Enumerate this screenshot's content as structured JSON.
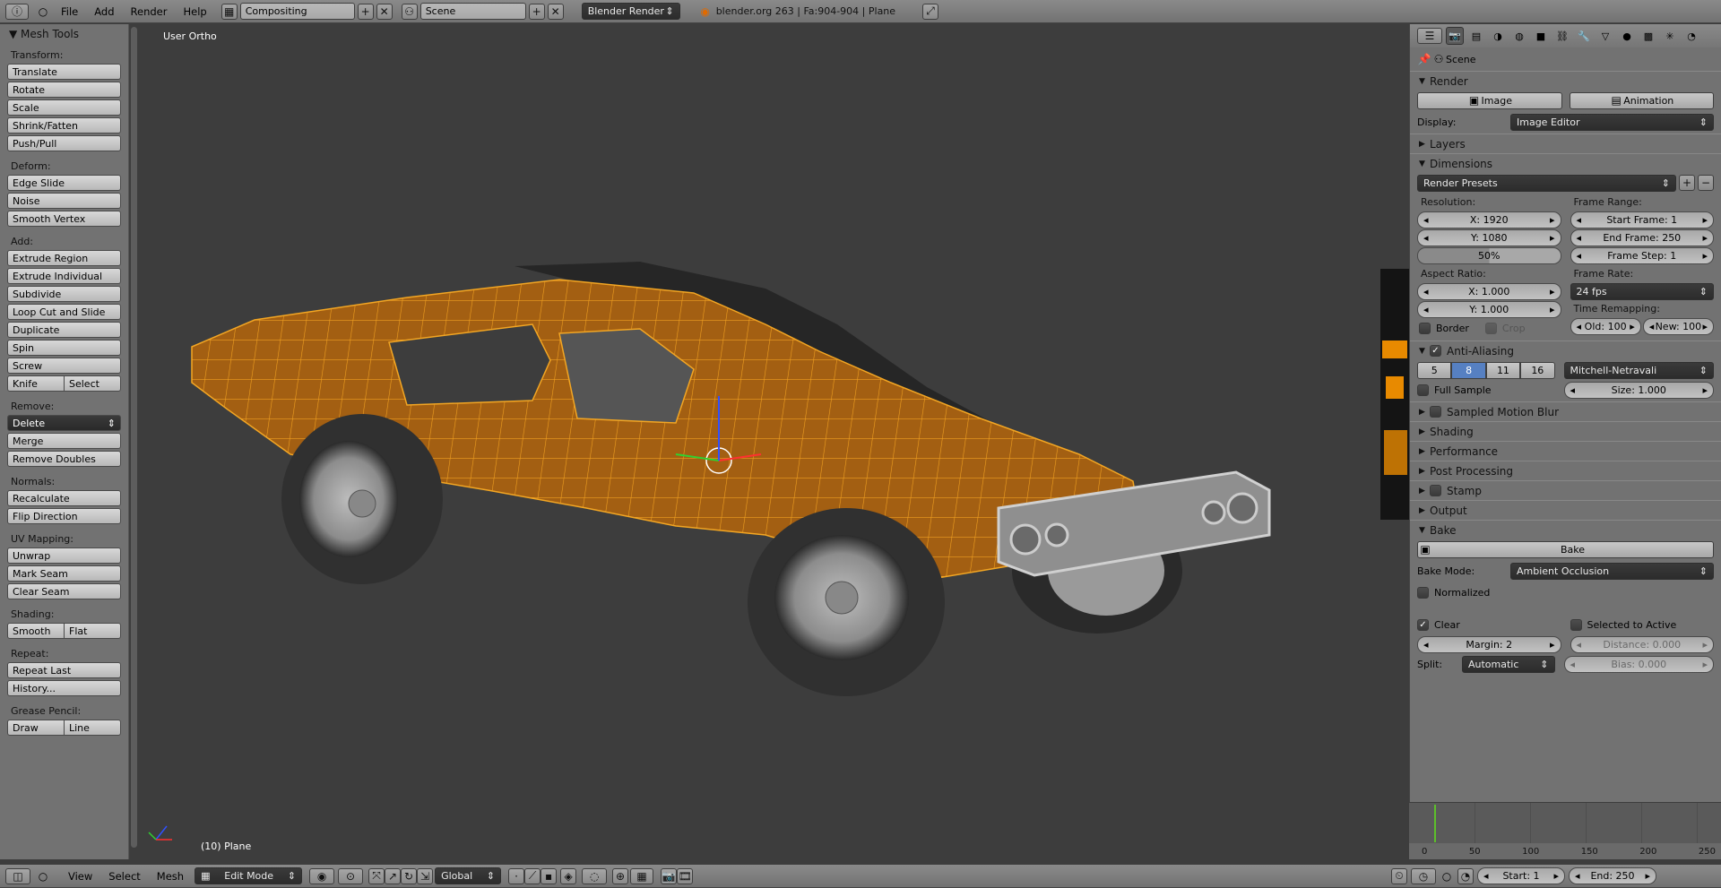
{
  "top": {
    "menus": [
      "File",
      "Add",
      "Render",
      "Help"
    ],
    "layout": "Compositing",
    "scene": "Scene",
    "engine": "Blender Render",
    "status": "blender.org 263 | Fa:904-904 | Plane"
  },
  "toolshelf": {
    "title": "Mesh Tools",
    "transform_label": "Transform:",
    "transform": [
      "Translate",
      "Rotate",
      "Scale",
      "Shrink/Fatten",
      "Push/Pull"
    ],
    "deform_label": "Deform:",
    "deform": [
      "Edge Slide",
      "Noise",
      "Smooth Vertex"
    ],
    "add_label": "Add:",
    "add": [
      "Extrude Region",
      "Extrude Individual",
      "Subdivide",
      "Loop Cut and Slide",
      "Duplicate",
      "Spin",
      "Screw"
    ],
    "knife": "Knife",
    "select": "Select",
    "remove_label": "Remove:",
    "delete": "Delete",
    "remove": [
      "Merge",
      "Remove Doubles"
    ],
    "normals_label": "Normals:",
    "normals": [
      "Recalculate",
      "Flip Direction"
    ],
    "uv_label": "UV Mapping:",
    "uv": [
      "Unwrap",
      "Mark Seam",
      "Clear Seam"
    ],
    "shading_label": "Shading:",
    "smooth": "Smooth",
    "flat": "Flat",
    "repeat_label": "Repeat:",
    "repeat": [
      "Repeat Last",
      "History..."
    ],
    "grease_label": "Grease Pencil:",
    "draw": "Draw",
    "line": "Line"
  },
  "viewport": {
    "view_name": "User Ortho",
    "object_label": "(10) Plane"
  },
  "props": {
    "context": "Scene",
    "render_panel": "Render",
    "image_btn": "Image",
    "animation_btn": "Animation",
    "display_label": "Display:",
    "display_value": "Image Editor",
    "layers_panel": "Layers",
    "dimensions_panel": "Dimensions",
    "presets": "Render Presets",
    "resolution_label": "Resolution:",
    "res_x": "X: 1920",
    "res_y": "Y: 1080",
    "res_pct": "50%",
    "frame_range_label": "Frame Range:",
    "start_frame": "Start Frame: 1",
    "end_frame": "End Frame: 250",
    "frame_step": "Frame Step: 1",
    "aspect_label": "Aspect Ratio:",
    "aspect_x": "X: 1.000",
    "aspect_y": "Y: 1.000",
    "frame_rate_label": "Frame Rate:",
    "fps": "24 fps",
    "border": "Border",
    "crop": "Crop",
    "time_remap_label": "Time Remapping:",
    "old": "Old: 100",
    "new": "New: 100",
    "aa_panel": "Anti-Aliasing",
    "aa_samples": [
      "5",
      "8",
      "11",
      "16"
    ],
    "aa_filter": "Mitchell-Netravali",
    "full_sample": "Full Sample",
    "aa_size": "Size: 1.000",
    "smb_panel": "Sampled Motion Blur",
    "shading_panel": "Shading",
    "performance_panel": "Performance",
    "post_panel": "Post Processing",
    "stamp_panel": "Stamp",
    "output_panel": "Output",
    "bake_panel": "Bake",
    "bake_btn": "Bake",
    "bake_mode_label": "Bake Mode:",
    "bake_mode": "Ambient Occlusion",
    "normalized": "Normalized",
    "clear": "Clear",
    "selected_to_active": "Selected to Active",
    "margin": "Margin: 2",
    "distance": "Distance: 0.000",
    "split_label": "Split:",
    "split_value": "Automatic",
    "bias": "Bias: 0.000"
  },
  "timeline": {
    "ticks": [
      "0",
      "50",
      "100",
      "150",
      "200",
      "250"
    ]
  },
  "bottom": {
    "menus": [
      "View",
      "Select",
      "Mesh"
    ],
    "mode": "Edit Mode",
    "orientation": "Global",
    "start": "Start: 1",
    "end": "End: 250"
  },
  "colors": {
    "mesh_orange": "#e8960f",
    "active_blue": "#5680c2"
  }
}
